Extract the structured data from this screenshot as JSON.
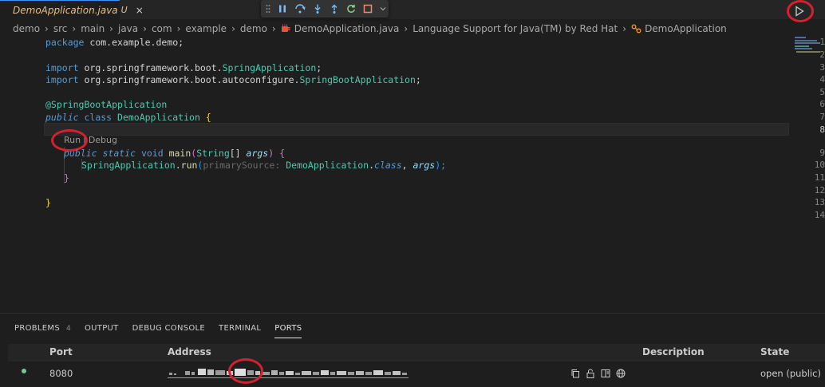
{
  "tab": {
    "title": "DemoApplication.java",
    "modified": "U",
    "close": "×"
  },
  "breadcrumb": [
    "demo",
    "src",
    "main",
    "java",
    "com",
    "example",
    "demo",
    "DemoApplication.java",
    "Language Support for Java(TM) by Red Hat",
    "DemoApplication"
  ],
  "breadcrumb_sep": "›",
  "editor": {
    "line_numbers": [
      "1",
      "2",
      "3",
      "4",
      "5",
      "6",
      "7",
      "8",
      "9",
      "10",
      "11",
      "12",
      "13",
      "14"
    ],
    "active_line": "8",
    "lines": {
      "l1a": "package",
      "l1b": " com.example.demo;",
      "l3a": "import",
      "l3b": " org.springframework.boot.",
      "l3c": "SpringApplication",
      "l3d": ";",
      "l4a": "import",
      "l4b": " org.springframework.boot.autoconfigure.",
      "l4c": "SpringBootApplication",
      "l4d": ";",
      "l6a": "@SpringBootApplication",
      "l7a": "public",
      "l7b": " class",
      "l7c": " DemoApplication",
      "l7d": " {",
      "l9a": "public",
      "l9b": " static",
      "l9c": " void",
      "l9d": " main",
      "l9e": "(",
      "l9f": "String",
      "l9g": "[]",
      "l9h": " args",
      "l9i": ")",
      "l9j": " {",
      "l10a": "SpringApplication",
      "l10b": ".",
      "l10c": "run",
      "l10d": "(",
      "l10e": "primarySource:",
      "l10f": " DemoApplication",
      "l10g": ".",
      "l10h": "class",
      "l10i": ", ",
      "l10j": "args",
      "l10k": ");",
      "l11a": "}",
      "l13a": "}"
    },
    "codelens": {
      "run": "Run",
      "sep": "|",
      "debug": "Debug"
    }
  },
  "panel": {
    "tabs": [
      "PROBLEMS",
      "OUTPUT",
      "DEBUG CONSOLE",
      "TERMINAL",
      "PORTS"
    ],
    "problems_count": "4",
    "active_tab": "PORTS",
    "ports": {
      "columns": {
        "port": "Port",
        "address": "Address",
        "description": "Description",
        "state": "State"
      },
      "row": {
        "port": "8080",
        "state": "open (public)"
      }
    }
  },
  "colors": {
    "accent": "#3794ff",
    "highlight_circle": "#d4202f",
    "status_dot": "#73c991"
  },
  "icons": [
    "java-file-icon",
    "pause-icon",
    "step-over-icon",
    "step-into-icon",
    "step-out-icon",
    "restart-icon",
    "stop-icon",
    "run-icon",
    "copy-icon",
    "lock-icon",
    "preview-icon",
    "globe-icon"
  ]
}
